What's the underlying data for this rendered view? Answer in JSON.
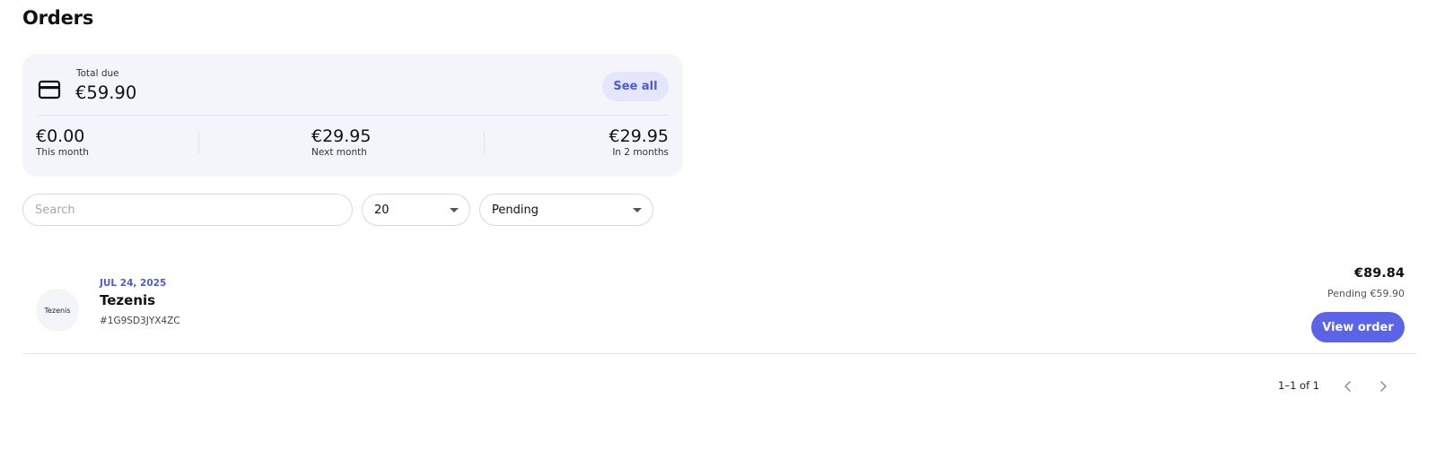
{
  "page": {
    "title": "Orders"
  },
  "summary": {
    "total_label": "Total due",
    "total_value": "€59.90",
    "see_all_label": "See all",
    "stats": [
      {
        "amount": "€0.00",
        "label": "This month"
      },
      {
        "amount": "€29.95",
        "label": "Next month"
      },
      {
        "amount": "€29.95",
        "label": "In 2 months"
      }
    ]
  },
  "filters": {
    "search_placeholder": "Search",
    "page_size": "20",
    "status": "Pending"
  },
  "orders": [
    {
      "date": "JUL 24, 2025",
      "merchant": "Tezenis",
      "merchant_logo_text": "Tezenis",
      "id": "#1G9SD3JYX4ZC",
      "total": "€89.84",
      "pending": "Pending €59.90",
      "action_label": "View order"
    }
  ],
  "pagination": {
    "range_text": "1–1 of 1"
  },
  "icons": {
    "card": "credit-card-icon",
    "prev": "chevron-left-icon",
    "next": "chevron-right-icon",
    "dropdown": "caret-down-icon"
  },
  "colors": {
    "accent": "#5b63e8",
    "accent_text": "#4f5bd5",
    "card_bg": "#f4f5fa",
    "see_all_bg": "#e4e6fb"
  }
}
